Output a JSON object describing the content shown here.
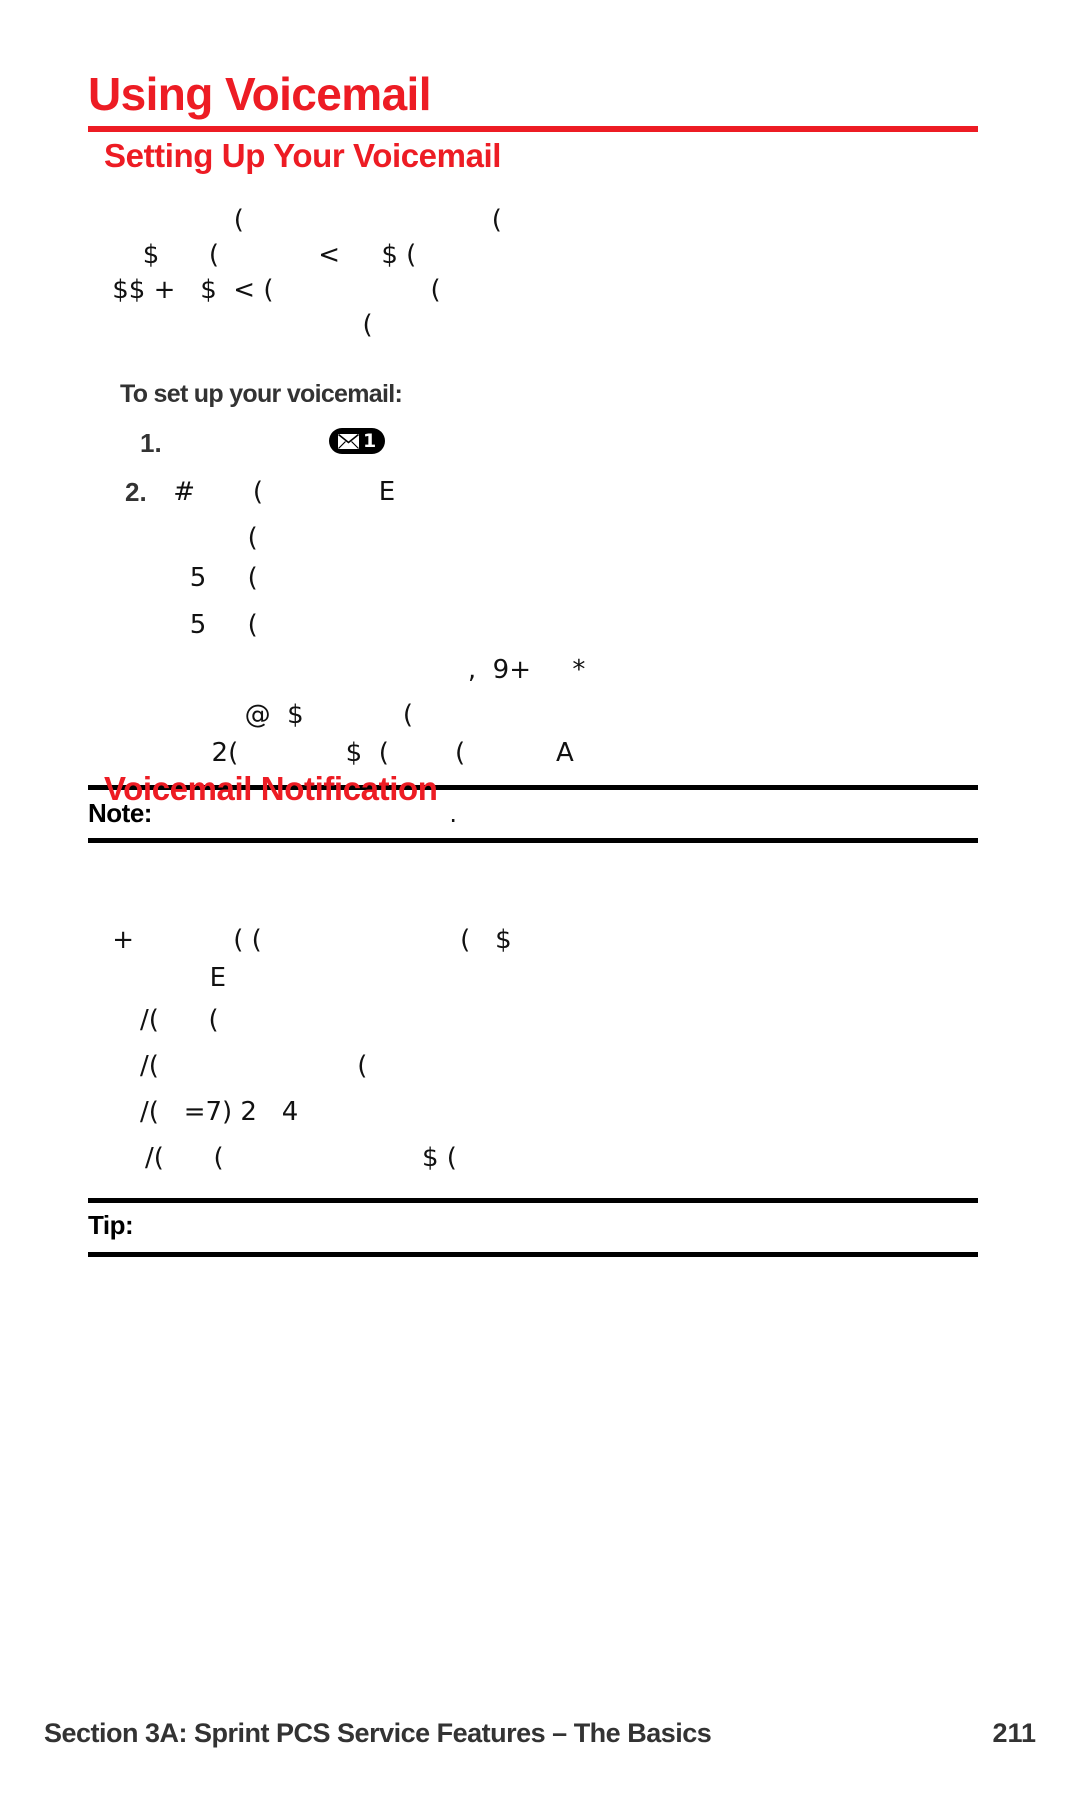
{
  "document": {
    "title": "Using Voicemail",
    "page_number": "211",
    "footer": "Section 3A: Sprint PCS Service Features – The Basics",
    "accent_color": "#ED1C24",
    "text_color": "#111111"
  },
  "sections": [
    {
      "heading": "Setting Up Your Voicemail",
      "intro_lines": [
        "              (                              (",
        "   $      (            <     $ (",
        " $$ +   $  < (                   (",
        "                 ("
      ],
      "runin_head": "To set up your voicemail:",
      "steps": [
        {
          "number": "1.",
          "text": ""
        },
        {
          "number": "2.",
          "text": " #       (              E"
        }
      ],
      "step_detail_lines": [
        "          (",
        "   5     (",
        "   5     (",
        "                          ,  9+     *",
        "      @  $            (",
        "  2(             $  (        (           A"
      ]
    },
    {
      "heading": "Voicemail Notification",
      "intro_lines": [
        " +            ( (                        (   $",
        "      E"
      ],
      "bullets": [
        "/(      (",
        "/(                        (",
        "/(   =7) 2   4",
        "/(      (                        $ ("
      ]
    }
  ],
  "callouts": [
    {
      "label": "Note:",
      "body": "                                  ."
    },
    {
      "label": "Tip:",
      "body": ""
    }
  ],
  "icons": {
    "envelope_badge": {
      "glyph": "envelope-icon",
      "count": "1"
    }
  }
}
